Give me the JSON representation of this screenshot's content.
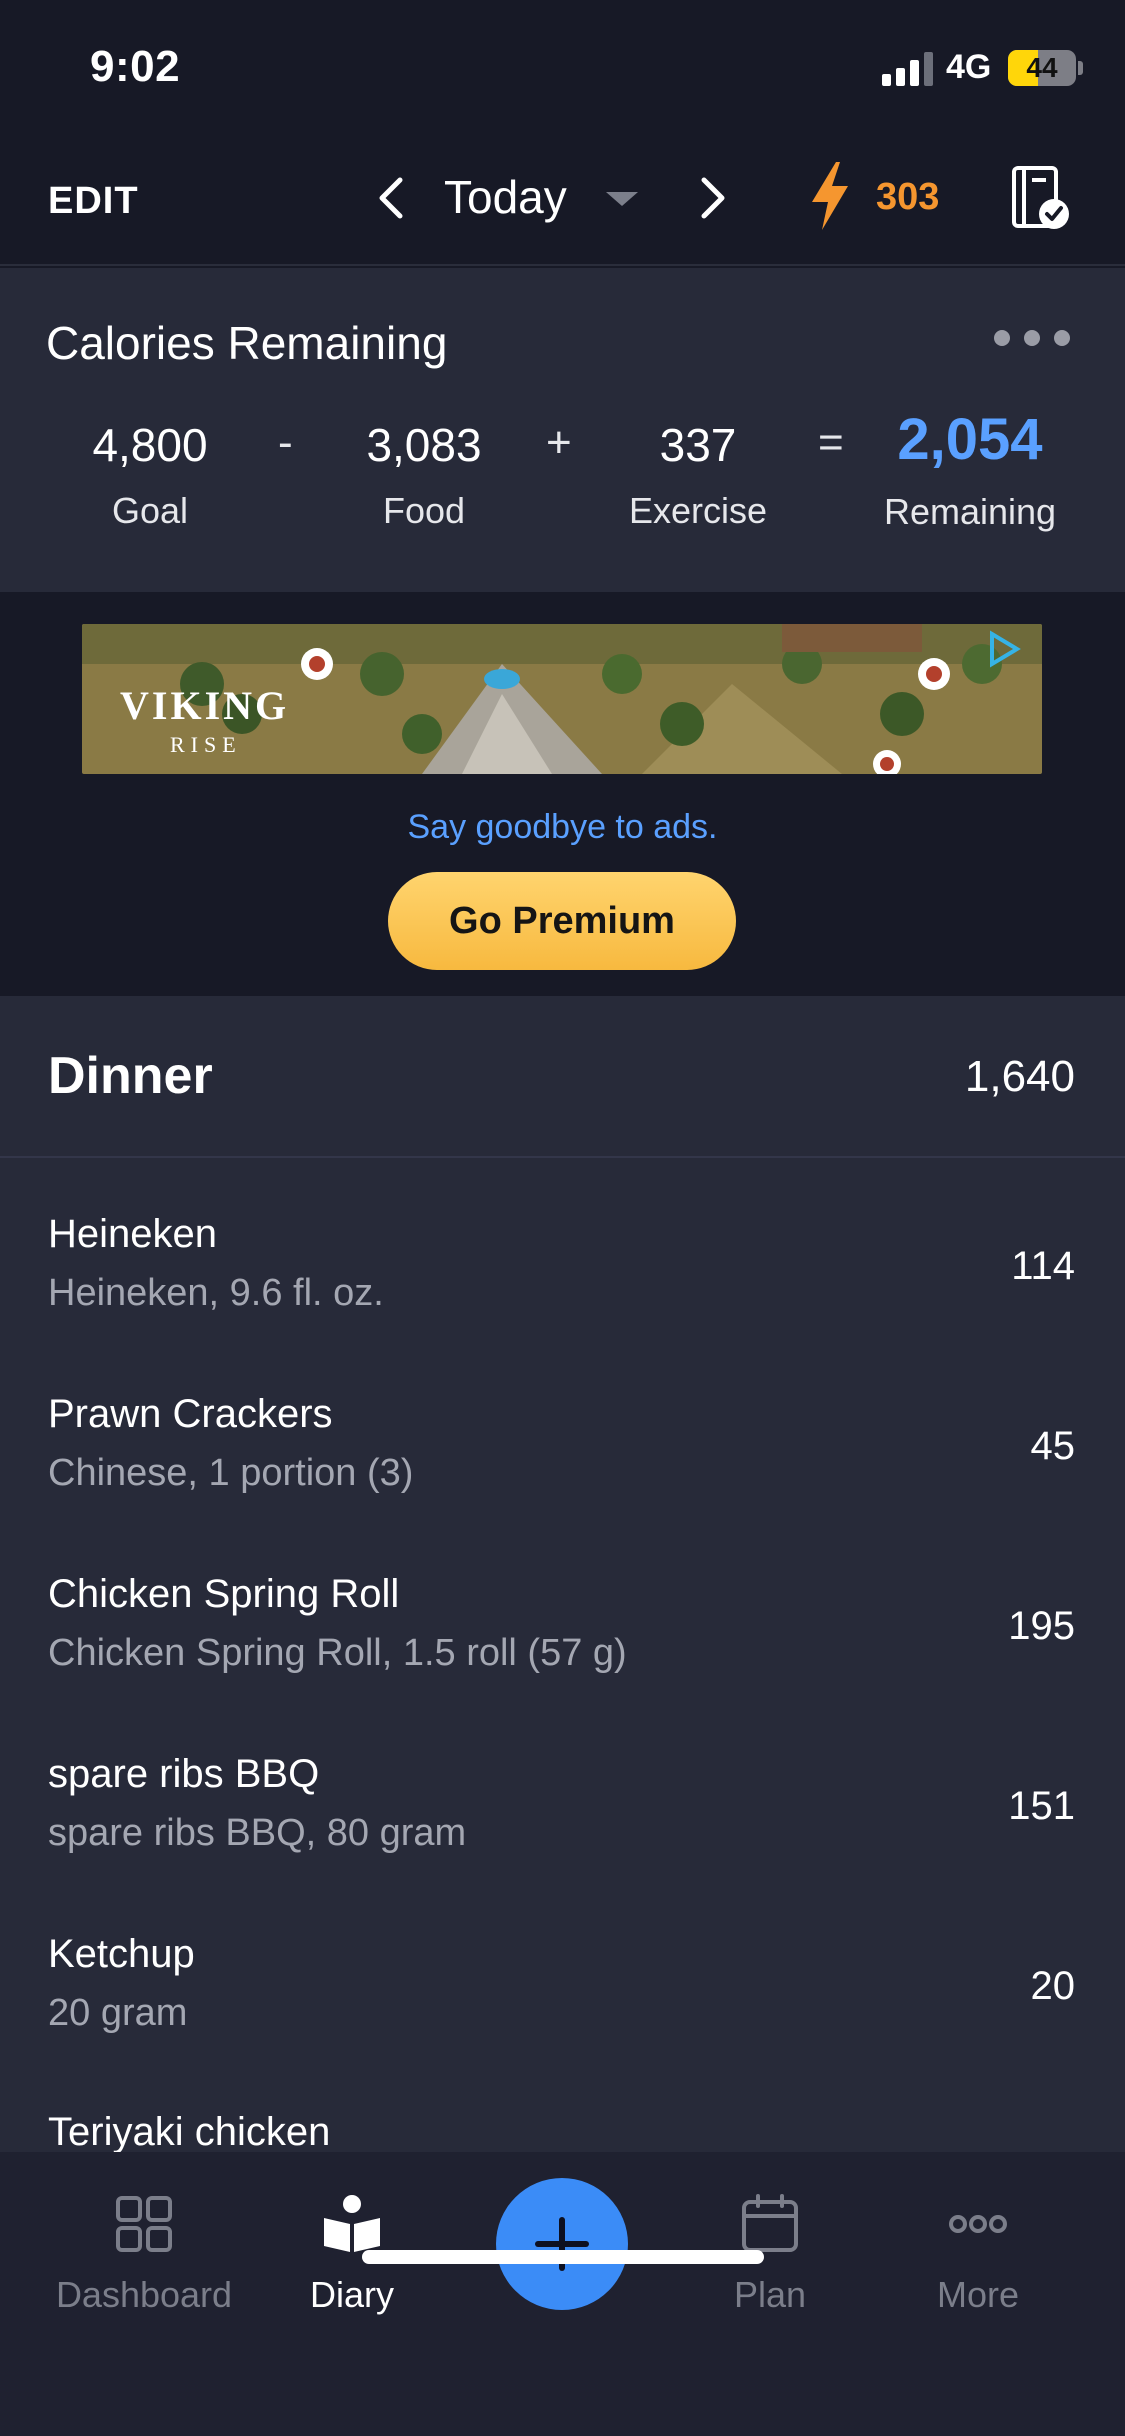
{
  "status_bar": {
    "time": "9:02",
    "network": "4G",
    "battery": "44",
    "battery_level": 0.44
  },
  "header": {
    "edit_label": "EDIT",
    "date_label": "Today",
    "streak_count": "303",
    "icons": [
      "chevron-left-icon",
      "chevron-right-icon",
      "dropdown-caret-icon",
      "lightning-bolt-icon",
      "checklist-icon"
    ]
  },
  "calories": {
    "title": "Calories Remaining",
    "goal": {
      "value": "4,800",
      "label": "Goal"
    },
    "food": {
      "value": "3,083",
      "label": "Food"
    },
    "exercise": {
      "value": "337",
      "label": "Exercise"
    },
    "remaining": {
      "value": "2,054",
      "label": "Remaining"
    },
    "op_minus": "-",
    "op_plus": "+",
    "op_equals": "=",
    "remaining_color": "#5aa0ff"
  },
  "ad": {
    "brand_line1": "VIKING",
    "brand_line2": "RISE",
    "tagline": "Say goodbye to ads.",
    "premium_label": "Go Premium",
    "premium_color": "#f7b93f"
  },
  "meal": {
    "name": "Dinner",
    "total": "1,640",
    "items": [
      {
        "name": "Heineken",
        "desc": "Heineken, 9.6 fl. oz.",
        "cal": "114"
      },
      {
        "name": "Prawn Crackers",
        "desc": "Chinese, 1 portion (3)",
        "cal": "45"
      },
      {
        "name": "Chicken Spring Roll",
        "desc": "Chicken Spring Roll, 1.5 roll (57 g)",
        "cal": "195"
      },
      {
        "name": "spare ribs BBQ",
        "desc": "spare ribs BBQ, 80 gram",
        "cal": "151"
      },
      {
        "name": "Ketchup",
        "desc": "20 gram",
        "cal": "20"
      },
      {
        "name": "Teriyaki chicken",
        "desc": "",
        "cal": ""
      }
    ]
  },
  "tabs": [
    {
      "label": "Dashboard",
      "icon": "dashboard-grid-icon",
      "active": false
    },
    {
      "label": "Diary",
      "icon": "diary-book-icon",
      "active": true
    },
    {
      "label": "",
      "icon": "plus-icon",
      "active": false
    },
    {
      "label": "Plan",
      "icon": "calendar-icon",
      "active": false
    },
    {
      "label": "More",
      "icon": "more-dots-icon",
      "active": false
    }
  ]
}
